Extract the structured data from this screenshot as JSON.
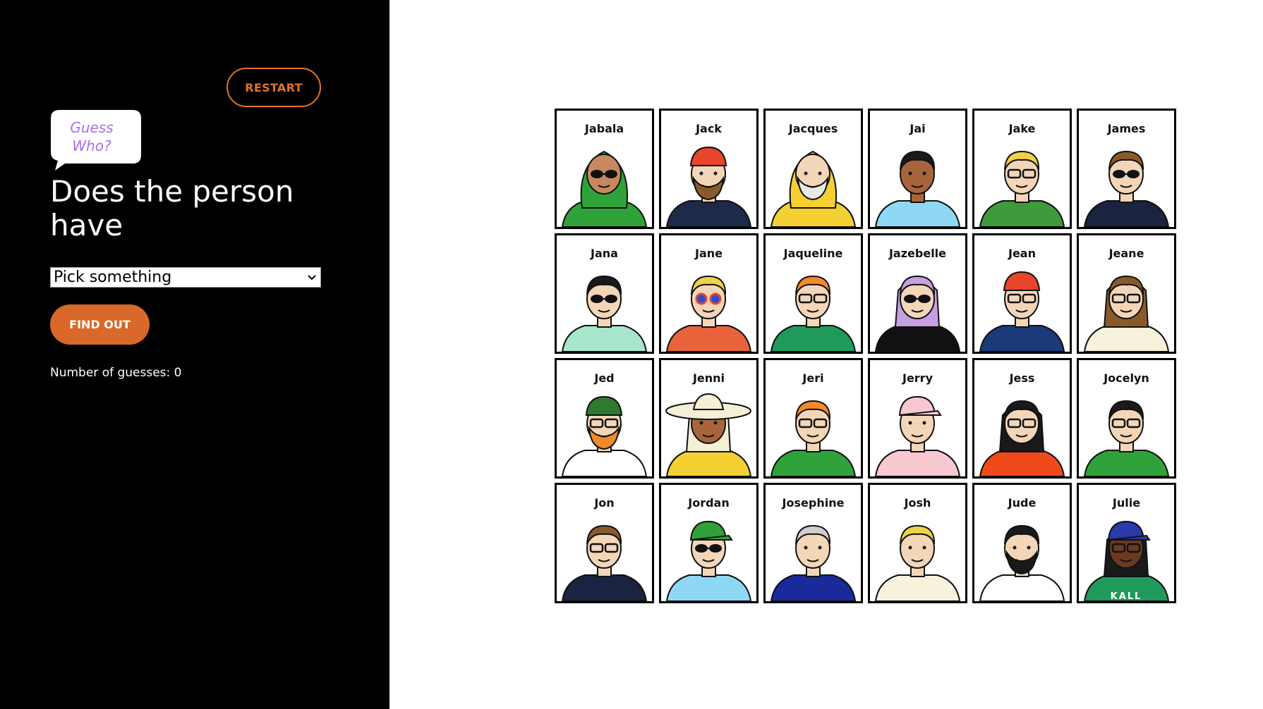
{
  "sidebar": {
    "restart_label": "RESTART",
    "logo_line1": "Guess",
    "logo_line2": "Who?",
    "question": "Does the person have",
    "select": {
      "selected": "Pick something"
    },
    "find_out_label": "FIND OUT",
    "guesses_text": "Number of guesses: 0"
  },
  "colors": {
    "sidebar_bg": "#000000",
    "accent_orange": "#e0722c",
    "logo_purple": "#a76df0"
  },
  "board": {
    "cards": [
      {
        "name": "Jabala",
        "skin": "#c68a5e",
        "hair": "#2fa33a",
        "shirt": "#2fa33a",
        "glasses": "sun",
        "hat": "hijab"
      },
      {
        "name": "Jack",
        "skin": "#f3d6b8",
        "hair": "#8a5a2b",
        "shirt": "#1e2a4a",
        "glasses": "none",
        "hat": "bandana"
      },
      {
        "name": "Jacques",
        "skin": "#f3d6b8",
        "hair": "#e8e8e8",
        "shirt": "#f4d033",
        "glasses": "none",
        "hat": "hood"
      },
      {
        "name": "Jai",
        "skin": "#a8653c",
        "hair": "#1a1a1a",
        "shirt": "#8fd8f5",
        "glasses": "none",
        "hat": "none"
      },
      {
        "name": "Jake",
        "skin": "#f3d6b8",
        "hair": "#f0d24a",
        "shirt": "#3e9a3a",
        "glasses": "clear",
        "hat": "none"
      },
      {
        "name": "James",
        "skin": "#f3d6b8",
        "hair": "#8a5a2b",
        "shirt": "#1a2340",
        "glasses": "sun",
        "hat": "none"
      },
      {
        "name": "Jana",
        "skin": "#f3d6b8",
        "hair": "#1a1a1a",
        "shirt": "#a8e6cc",
        "glasses": "sun",
        "hat": "none"
      },
      {
        "name": "Jane",
        "skin": "#f3d6b8",
        "hair": "#f0d24a",
        "shirt": "#e8623c",
        "glasses": "color",
        "hat": "none"
      },
      {
        "name": "Jaqueline",
        "skin": "#f3d6b8",
        "hair": "#f08a2a",
        "shirt": "#1f9a5a",
        "glasses": "clear",
        "hat": "none"
      },
      {
        "name": "Jazebelle",
        "skin": "#f3d6b8",
        "hair": "#c6a0e0",
        "shirt": "#111111",
        "glasses": "sun",
        "hat": "none"
      },
      {
        "name": "Jean",
        "skin": "#f3d6b8",
        "hair": "#e8e8e8",
        "shirt": "#1a3a7a",
        "glasses": "clear",
        "hat": "beanie-red"
      },
      {
        "name": "Jeane",
        "skin": "#f3d6b8",
        "hair": "#8a5a2b",
        "shirt": "#f7f2dc",
        "glasses": "clear",
        "hat": "none"
      },
      {
        "name": "Jed",
        "skin": "#f3d6b8",
        "hair": "#f08a2a",
        "shirt": "#ffffff",
        "glasses": "clear",
        "hat": "beanie-green"
      },
      {
        "name": "Jenni",
        "skin": "#a8653c",
        "hair": "#f4efd6",
        "shirt": "#f4d033",
        "glasses": "none",
        "hat": "sunhat"
      },
      {
        "name": "Jeri",
        "skin": "#f3d6b8",
        "hair": "#f08a2a",
        "shirt": "#2fa33a",
        "glasses": "clear",
        "hat": "none"
      },
      {
        "name": "Jerry",
        "skin": "#f3d6b8",
        "hair": "#e8e8e8",
        "shirt": "#f7c8d0",
        "glasses": "none",
        "hat": "cap-pink"
      },
      {
        "name": "Jess",
        "skin": "#f3d6b8",
        "hair": "#1a1a1a",
        "shirt": "#f04a1a",
        "glasses": "clear",
        "hat": "none"
      },
      {
        "name": "Jocelyn",
        "skin": "#f3d6b8",
        "hair": "#1a1a1a",
        "shirt": "#2fa33a",
        "glasses": "clear",
        "hat": "none"
      },
      {
        "name": "Jon",
        "skin": "#f3d6b8",
        "hair": "#8a5a2b",
        "shirt": "#1a2340",
        "glasses": "clear",
        "hat": "none"
      },
      {
        "name": "Jordan",
        "skin": "#f3d6b8",
        "hair": "#f0d24a",
        "shirt": "#8fd8f5",
        "glasses": "sun",
        "hat": "cap-green"
      },
      {
        "name": "Josephine",
        "skin": "#f3d6b8",
        "hair": "#cfcfcf",
        "shirt": "#1a2a9a",
        "glasses": "none",
        "hat": "none"
      },
      {
        "name": "Josh",
        "skin": "#f3d6b8",
        "hair": "#f0d24a",
        "shirt": "#f7f2dc",
        "glasses": "none",
        "hat": "none"
      },
      {
        "name": "Jude",
        "skin": "#f3d6b8",
        "hair": "#1a1a1a",
        "shirt": "#ffffff",
        "glasses": "none",
        "hat": "none"
      },
      {
        "name": "Julie",
        "skin": "#6b3a22",
        "hair": "#1a1a1a",
        "shirt": "#1f9a5a",
        "glasses": "clear",
        "hat": "cap-blue",
        "shirt_text": "KALL"
      }
    ]
  }
}
